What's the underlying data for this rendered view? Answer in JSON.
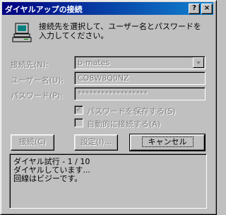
{
  "window": {
    "title": "ダイヤルアップの接続",
    "help_glyph": "?",
    "close_glyph": "×"
  },
  "intro_text": "接続先を選択して、ユーザー名とパスワードを入力してください。",
  "form": {
    "connect_to_label": "接続先(N):",
    "connect_to_value": "b-mates",
    "username_label": "ユーザー名(U):",
    "username_value": "CO8W8Q0NZ",
    "password_label": "パスワード(P):",
    "password_value": "******************",
    "save_password_label": "パスワードを保存する(S)",
    "save_password_checked": true,
    "auto_connect_label": "自動的に接続する(A)",
    "auto_connect_checked": false
  },
  "buttons": {
    "connect": "接続(C)",
    "settings": "設定(I)...",
    "cancel": "キャンセル"
  },
  "status_lines": [
    "ダイヤル試行 - 1 / 10",
    "ダイヤルしています...",
    "回線はビジーです。"
  ],
  "icons": {
    "computer": "computer-icon",
    "title": "dialup-icon"
  }
}
